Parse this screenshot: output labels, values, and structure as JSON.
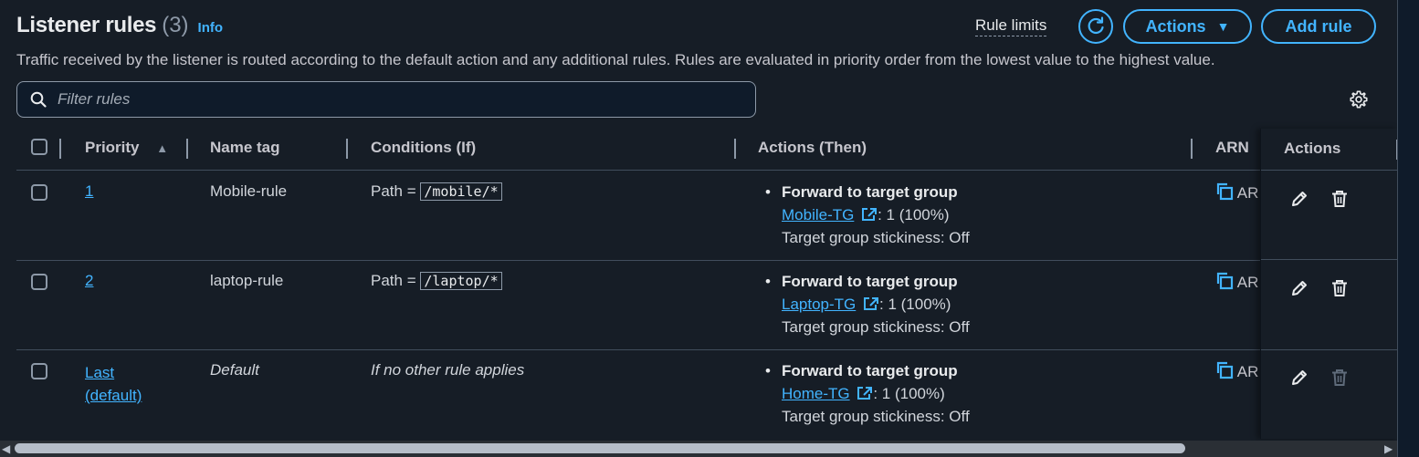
{
  "header": {
    "title": "Listener rules",
    "count": "(3)",
    "info": "Info",
    "description": "Traffic received by the listener is routed according to the default action and any additional rules. Rules are evaluated in priority order from the lowest value to the highest value.",
    "rule_limits": "Rule limits",
    "actions_label": "Actions",
    "add_rule_label": "Add rule"
  },
  "filter": {
    "placeholder": "Filter rules"
  },
  "columns": {
    "priority": "Priority",
    "name_tag": "Name tag",
    "conditions": "Conditions (If)",
    "actions_then": "Actions (Then)",
    "arn": "ARN",
    "actions": "Actions"
  },
  "rows": [
    {
      "priority": "1",
      "name_tag": "Mobile-rule",
      "condition_prefix": "Path =",
      "condition_value": "/mobile/*",
      "action_title": "Forward to target group",
      "target_group": "Mobile-TG",
      "weight": ": 1 (100%)",
      "stickiness": "Target group stickiness: Off",
      "arn": "AR"
    },
    {
      "priority": "2",
      "name_tag": "laptop-rule",
      "condition_prefix": "Path =",
      "condition_value": "/laptop/*",
      "action_title": "Forward to target group",
      "target_group": "Laptop-TG",
      "weight": ": 1 (100%)",
      "stickiness": "Target group stickiness: Off",
      "arn": "AR"
    },
    {
      "priority_line1": "Last",
      "priority_line2": "(default)",
      "name_tag": "Default",
      "condition_text": "If no other rule applies",
      "action_title": "Forward to target group",
      "target_group": "Home-TG",
      "weight": ": 1 (100%)",
      "stickiness": "Target group stickiness: Off",
      "arn": "AR"
    }
  ],
  "colors": {
    "background": "#161d26",
    "accent": "#42b4ff",
    "text": "#d1d5db",
    "border": "#414d5c"
  }
}
